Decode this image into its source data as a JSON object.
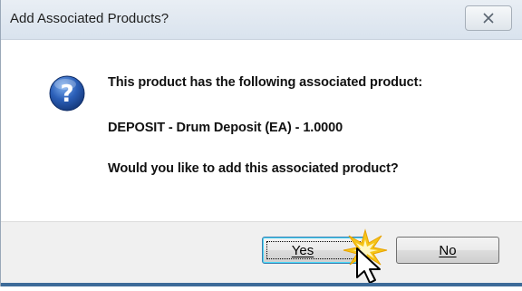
{
  "window": {
    "title": "Add Associated Products?"
  },
  "icons": {
    "dialog_icon": "question-icon",
    "close_icon": "close-icon",
    "cursor_icon": "mouse-pointer-icon",
    "click_icon": "click-burst-icon"
  },
  "message": {
    "line1": "This product has the following associated product:",
    "line2": "DEPOSIT - Drum Deposit (EA) - 1.0000",
    "line3": "Would you like to add this associated product?"
  },
  "buttons": {
    "yes_label": "Yes",
    "no_label": "No"
  },
  "colors": {
    "question_icon": "#2b5fb8",
    "focus_button_border": "#3c7fb1",
    "click_burst": "#f5c518"
  }
}
